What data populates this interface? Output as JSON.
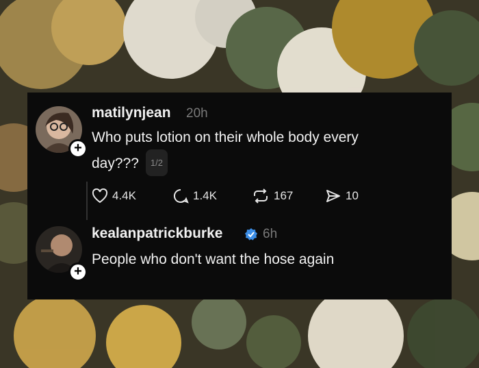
{
  "post": {
    "username": "matilynjean",
    "time": "20h",
    "text": "Who puts lotion on their whole body every day???",
    "text_line1": "Who puts lotion on their whole body every",
    "text_line2": "day???",
    "pager": "1/2",
    "plus": "+",
    "stats": {
      "likes": "4.4K",
      "replies": "1.4K",
      "reposts": "167",
      "shares": "10"
    }
  },
  "reply": {
    "username": "kealanpatrickburke",
    "time": "6h",
    "text": "People who don't want the hose again",
    "plus": "+"
  },
  "colors": {
    "card": "#0b0b0b",
    "verified": "#3b8de6",
    "muted": "#7a7a7a"
  },
  "icons": [
    "heart-icon",
    "comment-icon",
    "repost-icon",
    "share-icon",
    "verified-badge-icon",
    "follow-plus-icon"
  ]
}
